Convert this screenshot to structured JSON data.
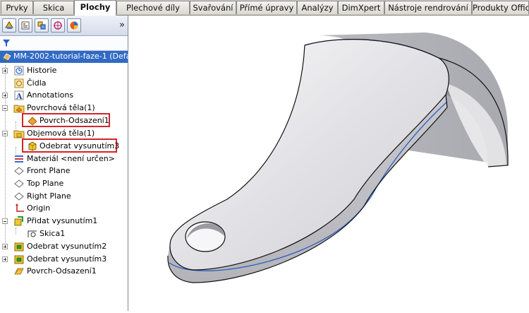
{
  "tabs": [
    {
      "label": "Prvky",
      "active": false
    },
    {
      "label": "Skica",
      "active": false
    },
    {
      "label": "Plochy",
      "active": true
    },
    {
      "label": "Plechové díly",
      "active": false
    },
    {
      "label": "Svařování",
      "active": false
    },
    {
      "label": "Přímé úpravy",
      "active": false
    },
    {
      "label": "Analýzy",
      "active": false
    },
    {
      "label": "DimXpert",
      "active": false
    },
    {
      "label": "Nástroje rendrování",
      "active": false
    },
    {
      "label": "Produkty Office",
      "active": false
    }
  ],
  "panel": {
    "toolbar_icons": [
      "feature-manager-icon",
      "property-manager-icon",
      "configuration-manager-icon",
      "dimxpert-manager-icon",
      "display-manager-icon"
    ],
    "more_glyph": "»",
    "filter_icon": "filter-icon"
  },
  "tree": {
    "root_label": "MM-2002-tutorial-faze-1  (Defa",
    "items": [
      {
        "label": "Historie",
        "icon": "history-icon",
        "expander": "plus",
        "level": 0
      },
      {
        "label": "Čidla",
        "icon": "sensors-icon",
        "expander": "none",
        "level": 0
      },
      {
        "label": "Annotations",
        "icon": "annotations-icon",
        "expander": "plus",
        "level": 0
      },
      {
        "label": "Povrchová těla(1)",
        "icon": "surface-bodies-folder-icon",
        "expander": "minus",
        "level": 0
      },
      {
        "label": "Povrch-Odsazení1",
        "icon": "surface-body-icon",
        "expander": "none",
        "level": 1,
        "highlighted": true
      },
      {
        "label": "Objemová těla(1)",
        "icon": "solid-bodies-folder-icon",
        "expander": "minus",
        "level": 0
      },
      {
        "label": "Odebrat vysunutím3",
        "icon": "solid-body-icon",
        "expander": "none",
        "level": 1,
        "highlighted": true
      },
      {
        "label": "Materiál <není určen>",
        "icon": "material-icon",
        "expander": "none",
        "level": 0
      },
      {
        "label": "Front Plane",
        "icon": "plane-icon",
        "expander": "none",
        "level": 0
      },
      {
        "label": "Top Plane",
        "icon": "plane-icon",
        "expander": "none",
        "level": 0
      },
      {
        "label": "Right Plane",
        "icon": "plane-icon",
        "expander": "none",
        "level": 0
      },
      {
        "label": "Origin",
        "icon": "origin-icon",
        "expander": "none",
        "level": 0
      },
      {
        "label": "Přidat vysunutím1",
        "icon": "boss-extrude-icon",
        "expander": "minus",
        "level": 0
      },
      {
        "label": "Skica1",
        "icon": "sketch-icon",
        "expander": "none",
        "level": 1
      },
      {
        "label": "Odebrat vysunutím2",
        "icon": "cut-extrude-icon",
        "expander": "plus",
        "level": 0
      },
      {
        "label": "Odebrat vysunutím3",
        "icon": "cut-extrude-icon",
        "expander": "plus",
        "level": 0
      },
      {
        "label": "Povrch-Odsazení1",
        "icon": "offset-surface-icon",
        "expander": "none",
        "level": 0
      }
    ]
  },
  "colors": {
    "selection": "#316ac5",
    "highlight_border": "#d0262a",
    "model_face": "#d9d9dc",
    "model_edge": "#1c3f7a"
  }
}
